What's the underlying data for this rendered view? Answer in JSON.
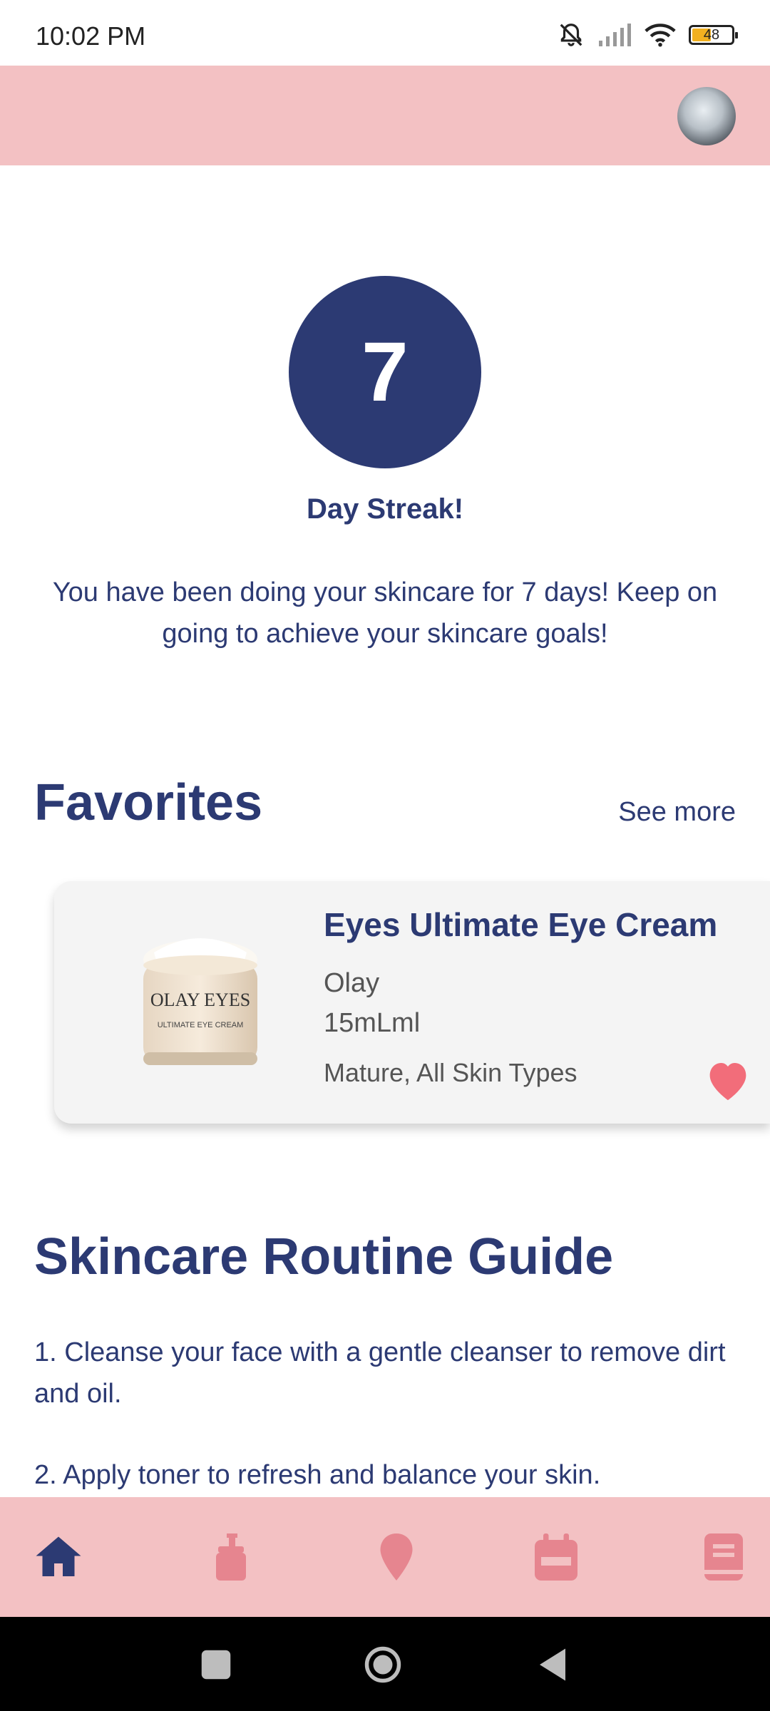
{
  "status_bar": {
    "time": "10:02 PM",
    "battery_level": "48",
    "icons": [
      "bell-off-icon",
      "signal-icon",
      "wifi-icon",
      "battery-icon"
    ]
  },
  "app_bar": {
    "avatar_icon": "user-avatar"
  },
  "streak": {
    "days": "7",
    "title": "Day Streak!",
    "message": "You have been doing your skincare for 7 days! Keep on going to achieve your skincare goals!"
  },
  "favorites": {
    "title": "Favorites",
    "see_more": "See more",
    "items": [
      {
        "name": "Eyes Ultimate Eye Cream",
        "brand": "Olay",
        "size": "15mLml",
        "skin_type": "Mature, All Skin Types",
        "favorited": true,
        "jar_label_brand": "OLAY EYES",
        "jar_label_product": "ULTIMATE EYE CREAM"
      }
    ]
  },
  "guide": {
    "title": "Skincare Routine Guide",
    "steps": [
      "1. Cleanse your face with a gentle cleanser to remove dirt and oil.",
      "2. Apply toner to refresh and balance your skin."
    ]
  },
  "bottom_nav": {
    "items": [
      "home-icon",
      "products-icon",
      "location-icon",
      "calendar-icon",
      "journal-icon"
    ],
    "active": "home-icon"
  },
  "colors": {
    "primary": "#2c3a73",
    "accent_pink": "#f3c1c3",
    "heart": "#f26d7a",
    "nav_inactive": "#e6858f"
  }
}
